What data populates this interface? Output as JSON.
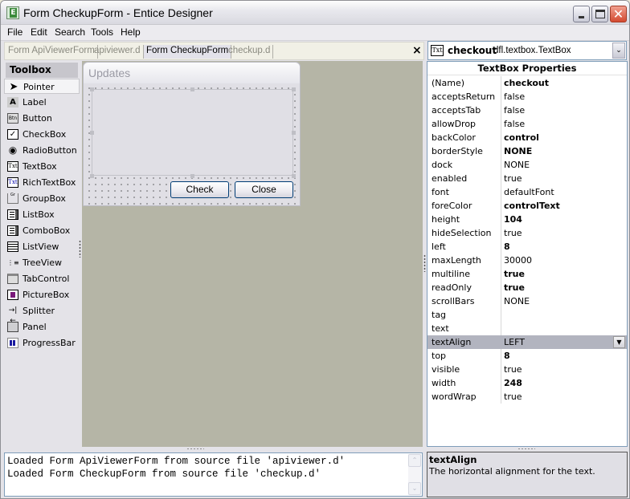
{
  "window": {
    "title": "Form CheckupForm - Entice Designer",
    "app_icon": "entice-app-icon",
    "controls": {
      "minimize": "minimize-icon",
      "maximize": "maximize-icon",
      "close": "close-icon",
      "close_glyph": "✕"
    }
  },
  "menu": [
    "File",
    "Edit",
    "Search",
    "Tools",
    "Help"
  ],
  "tabs": [
    {
      "label": "Form ApiViewerForm",
      "active": false
    },
    {
      "label": "apiviewer.d",
      "active": false
    },
    {
      "label": "Form CheckupForm",
      "active": true
    },
    {
      "label": "checkup.d",
      "active": false
    }
  ],
  "tab_close_glyph": "×",
  "component_selector": {
    "icon_text": "Txt",
    "name": "checkout",
    "type": "dfl.textbox.TextBox",
    "dropdown_glyph": "⌄"
  },
  "toolbox": {
    "title": "Toolbox",
    "items": [
      {
        "label": "Pointer",
        "icon": "pointer-icon",
        "glyph": "➤",
        "selected": true
      },
      {
        "label": "Label",
        "icon": "label-icon",
        "glyph": "A"
      },
      {
        "label": "Button",
        "icon": "button-icon",
        "glyph": "Btn"
      },
      {
        "label": "CheckBox",
        "icon": "checkbox-icon",
        "glyph": "✓"
      },
      {
        "label": "RadioButton",
        "icon": "radiobutton-icon",
        "glyph": "◉"
      },
      {
        "label": "TextBox",
        "icon": "textbox-icon",
        "glyph": "Txt"
      },
      {
        "label": "RichTextBox",
        "icon": "richtextbox-icon",
        "glyph": "Txt"
      },
      {
        "label": "GroupBox",
        "icon": "groupbox-icon",
        "glyph": "Gr"
      },
      {
        "label": "ListBox",
        "icon": "listbox-icon",
        "glyph": ""
      },
      {
        "label": "ComboBox",
        "icon": "combobox-icon",
        "glyph": ""
      },
      {
        "label": "ListView",
        "icon": "listview-icon",
        "glyph": ""
      },
      {
        "label": "TreeView",
        "icon": "treeview-icon",
        "glyph": "⋮≡"
      },
      {
        "label": "TabControl",
        "icon": "tabcontrol-icon",
        "glyph": ""
      },
      {
        "label": "PictureBox",
        "icon": "picturebox-icon",
        "glyph": ""
      },
      {
        "label": "Splitter",
        "icon": "splitter-icon",
        "glyph": "→|←"
      },
      {
        "label": "Panel",
        "icon": "panel-icon",
        "glyph": ""
      },
      {
        "label": "ProgressBar",
        "icon": "progressbar-icon",
        "glyph": ""
      }
    ]
  },
  "designer": {
    "form_title": "Updates",
    "buttons": [
      "Check",
      "Close"
    ]
  },
  "properties": {
    "title": "TextBox Properties",
    "rows": [
      {
        "name": "(Name)",
        "value": "checkout",
        "bold": true
      },
      {
        "name": "acceptsReturn",
        "value": "false"
      },
      {
        "name": "acceptsTab",
        "value": "false"
      },
      {
        "name": "allowDrop",
        "value": "false"
      },
      {
        "name": "backColor",
        "value": "control",
        "bold": true
      },
      {
        "name": "borderStyle",
        "value": "NONE",
        "bold": true
      },
      {
        "name": "dock",
        "value": "NONE"
      },
      {
        "name": "enabled",
        "value": "true"
      },
      {
        "name": "font",
        "value": "defaultFont"
      },
      {
        "name": "foreColor",
        "value": "controlText",
        "bold": true
      },
      {
        "name": "height",
        "value": "104",
        "bold": true
      },
      {
        "name": "hideSelection",
        "value": "true"
      },
      {
        "name": "left",
        "value": "8",
        "bold": true
      },
      {
        "name": "maxLength",
        "value": "30000"
      },
      {
        "name": "multiline",
        "value": "true",
        "bold": true
      },
      {
        "name": "readOnly",
        "value": "true",
        "bold": true
      },
      {
        "name": "scrollBars",
        "value": "NONE"
      },
      {
        "name": "tag",
        "value": ""
      },
      {
        "name": "text",
        "value": ""
      },
      {
        "name": "textAlign",
        "value": "LEFT",
        "selected": true,
        "dropdown_glyph": "▼"
      },
      {
        "name": "top",
        "value": "8",
        "bold": true
      },
      {
        "name": "visible",
        "value": "true"
      },
      {
        "name": "width",
        "value": "248",
        "bold": true
      },
      {
        "name": "wordWrap",
        "value": "true"
      }
    ]
  },
  "output": {
    "lines": [
      "Loaded Form ApiViewerForm from source file 'apiviewer.d'",
      "Loaded Form CheckupForm from source file 'checkup.d'"
    ],
    "scroll_up_glyph": "⌃",
    "scroll_down_glyph": "⌄"
  },
  "help": {
    "title": "textAlign",
    "description": "The horizontal alignment for the text."
  }
}
